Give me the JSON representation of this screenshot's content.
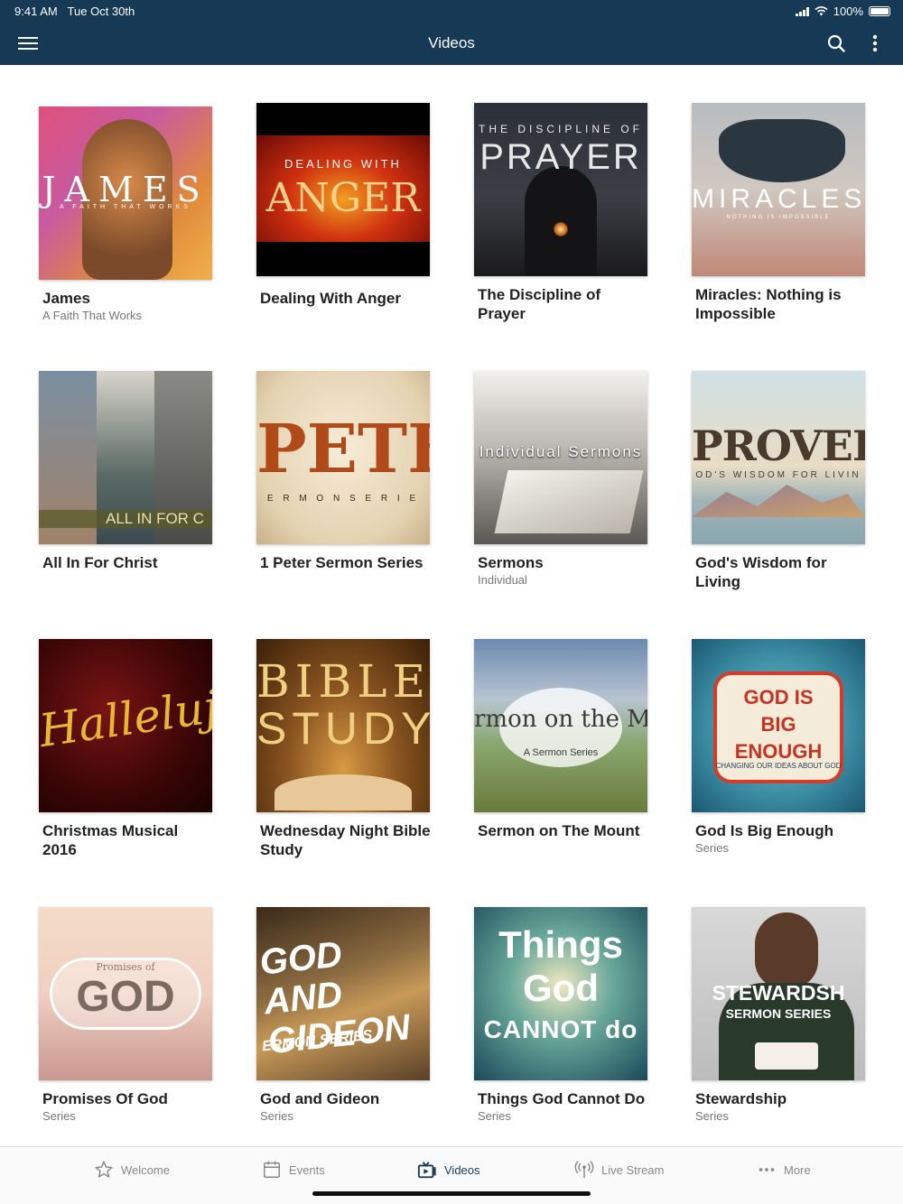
{
  "status": {
    "time": "9:41 AM",
    "date": "Tue Oct 30th",
    "battery": "100%"
  },
  "header": {
    "title": "Videos"
  },
  "videos": [
    {
      "title": "James",
      "subtitle": "A Faith That Works",
      "art": "JAMES",
      "art_sub": "A FAITH THAT WORKS"
    },
    {
      "title": "Dealing With Anger",
      "subtitle": "",
      "art": "ANGER",
      "art_sub": "DEALING WITH"
    },
    {
      "title": "The Discipline of Prayer",
      "subtitle": "",
      "art": "PRAYER",
      "art_sub": "THE DISCIPLINE OF"
    },
    {
      "title": "Miracles: Nothing is Impossible",
      "subtitle": "",
      "art": "MIRACLES",
      "art_sub": "NOTHING IS IMPOSSIBLE"
    },
    {
      "title": "All In For Christ",
      "subtitle": "",
      "art": "ALL IN FOR C",
      "art_sub": ""
    },
    {
      "title": "1 Peter Sermon Series",
      "subtitle": "",
      "art": "PETE",
      "art_sub": "E R M O N   S E R I E"
    },
    {
      "title": "Sermons",
      "subtitle": "Individual",
      "art": "Individual Sermons",
      "art_sub": ""
    },
    {
      "title": "God's Wisdom for Living",
      "subtitle": "",
      "art": "PROVERBS",
      "art_sub": "OD'S WISDOM FOR LIVIN"
    },
    {
      "title": "Christmas Musical 2016",
      "subtitle": "",
      "art": "Hallelujah",
      "art_sub": ""
    },
    {
      "title": "Wednesday Night Bible Study",
      "subtitle": "",
      "art": "BIBLE",
      "art_sub": "STUDY"
    },
    {
      "title": "Sermon on The Mount",
      "subtitle": "",
      "art": "rmon on the Mou",
      "art_sub": "A Sermon Series"
    },
    {
      "title": "God Is Big Enough",
      "subtitle": "Series",
      "art": "GOD IS BIG ENOUGH",
      "art_sub": "CHANGING OUR IDEAS ABOUT GOD"
    },
    {
      "title": "Promises Of God",
      "subtitle": "Series",
      "art": "GOD",
      "art_sub": "Promises of"
    },
    {
      "title": "God and Gideon",
      "subtitle": "Series",
      "art": "GOD AND GIDEON",
      "art_sub": "ERMON SERIES"
    },
    {
      "title": "Things God Cannot Do",
      "subtitle": "Series",
      "art": "Things God",
      "art_sub": "CANNOT do"
    },
    {
      "title": "Stewardship",
      "subtitle": "Series",
      "art": "STEWARDSH",
      "art_sub": "SERMON SERIES"
    }
  ],
  "tabs": [
    {
      "label": "Welcome",
      "icon": "star-icon"
    },
    {
      "label": "Events",
      "icon": "calendar-icon"
    },
    {
      "label": "Videos",
      "icon": "video-icon"
    },
    {
      "label": "Live Stream",
      "icon": "broadcast-icon"
    },
    {
      "label": "More",
      "icon": "more-dots-icon"
    }
  ],
  "colors": {
    "nav": "#163a55",
    "accent": "#163a55"
  }
}
